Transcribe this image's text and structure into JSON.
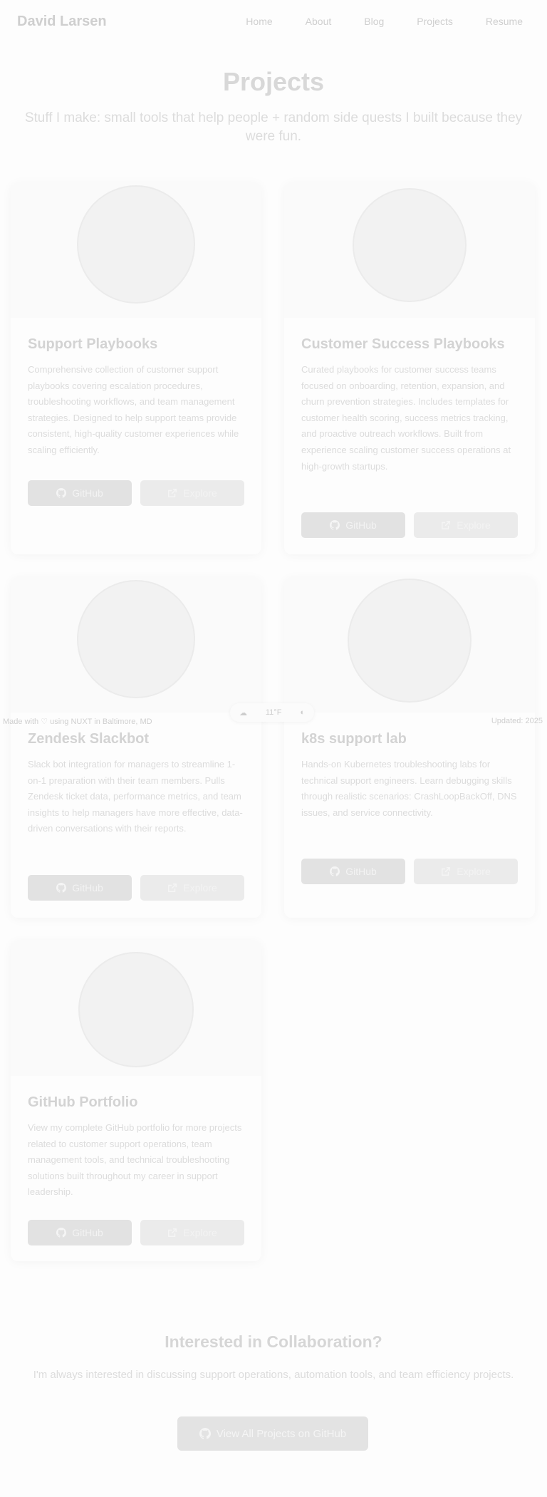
{
  "nav": {
    "brand": "David Larsen",
    "links": [
      "Home",
      "About",
      "Blog",
      "Projects",
      "Resume"
    ]
  },
  "hero": {
    "title": "Projects",
    "subtitle": "Stuff I make: small tools that help people + random side quests I built because they were fun."
  },
  "projects": [
    {
      "title": "Support Playbooks",
      "description": "Comprehensive collection of customer support playbooks covering escalation procedures, troubleshooting workflows, and team management strategies. Designed to help support teams provide consistent, high-quality customer experiences while scaling efficiently.",
      "github_label": "GitHub",
      "explore_label": "Explore",
      "image_icon": "help-desk-illustration"
    },
    {
      "title": "Customer Success Playbooks",
      "description": "Curated playbooks for customer success teams focused on onboarding, retention, expansion, and churn prevention strategies. Includes templates for customer health scoring, success metrics tracking, and proactive outreach workflows. Built from experience scaling customer success operations at high-growth startups.",
      "github_label": "GitHub",
      "explore_label": "Explore",
      "image_icon": "fox-illustration"
    },
    {
      "title": "Zendesk Slackbot",
      "description": "Slack bot integration for managers to streamline 1-on-1 preparation with their team members. Pulls Zendesk ticket data, performance metrics, and team insights to help managers have more effective, data-driven conversations with their reports.",
      "github_label": "GitHub",
      "explore_label": "Explore",
      "image_icon": "zendesk-raccoon-illustration"
    },
    {
      "title": "k8s support lab",
      "description": "Hands-on Kubernetes troubleshooting labs for technical support engineers. Learn debugging skills through realistic scenarios: CrashLoopBackOff, DNS issues, and service connectivity.",
      "github_label": "GitHub",
      "explore_label": "Explore",
      "image_icon": "fox-laptop-illustration"
    },
    {
      "title": "GitHub Portfolio",
      "description": "View my complete GitHub portfolio for more projects related to customer support operations, team management tools, and technical troubleshooting solutions built throughout my career in support leadership.",
      "github_label": "GitHub",
      "explore_label": "Explore",
      "image_icon": "raccoon-laptop-illustration"
    }
  ],
  "overlay": {
    "left": "Made with ♡ using NUXT in Baltimore, MD",
    "weather": "11",
    "weather_unit": "°F",
    "right": "Updated: 2025"
  },
  "cta": {
    "title": "Interested in Collaboration?",
    "text": "I'm always interested in discussing support operations, automation tools, and team efficiency projects.",
    "button_label": "View All Projects on GitHub"
  }
}
